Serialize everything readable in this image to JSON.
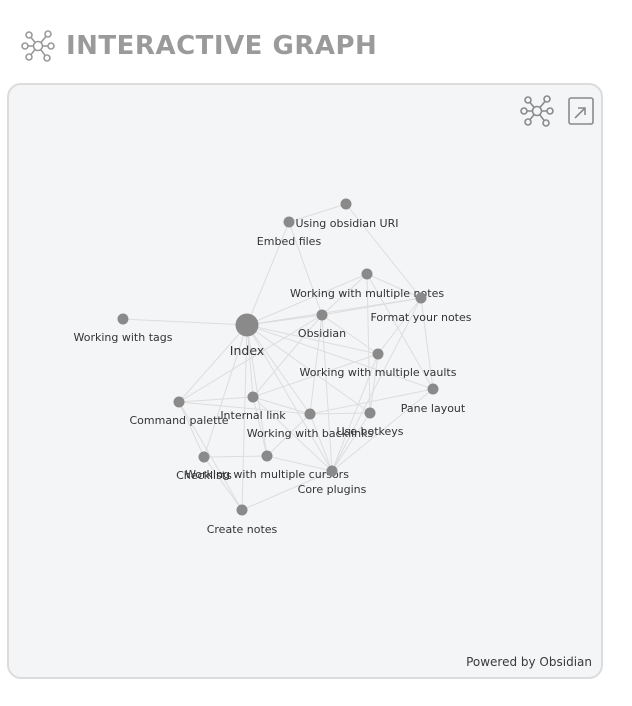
{
  "header": {
    "title": "INTERACTIVE GRAPH",
    "icon": "graph-network-icon"
  },
  "panel": {
    "toolbar": {
      "graph_icon": "graph-network-icon",
      "open_icon": "open-external-icon"
    },
    "footer": "Powered by Obsidian"
  },
  "colors": {
    "node": "#8a8a8a",
    "edge": "#dddddd",
    "panel_bg": "#f4f5f7",
    "header_text": "#9a9a9a"
  },
  "graph": {
    "nodes": [
      {
        "id": "top",
        "label": ""
      },
      {
        "id": "uri",
        "label": "Using obsidian URI"
      },
      {
        "id": "embed",
        "label": "Embed files"
      },
      {
        "id": "multnotes",
        "label": "Working with multiple notes"
      },
      {
        "id": "format",
        "label": "Format your notes"
      },
      {
        "id": "tags",
        "label": "Working with tags"
      },
      {
        "id": "index",
        "label": "Index"
      },
      {
        "id": "obsidian",
        "label": "Obsidian"
      },
      {
        "id": "vaults",
        "label": "Working with multiple vaults"
      },
      {
        "id": "pane",
        "label": "Pane layout"
      },
      {
        "id": "cmd",
        "label": "Command palette"
      },
      {
        "id": "internal",
        "label": "Internal link"
      },
      {
        "id": "backlinks",
        "label": "Working with backlinks"
      },
      {
        "id": "hotkeys",
        "label": "Use hotkeys"
      },
      {
        "id": "cursors",
        "label": "Working with multiple cursors"
      },
      {
        "id": "checklists",
        "label": "Checklists"
      },
      {
        "id": "core",
        "label": "Core plugins"
      },
      {
        "id": "create",
        "label": "Create notes"
      }
    ],
    "edges": [
      [
        "top",
        "embed"
      ],
      [
        "top",
        "format"
      ],
      [
        "uri",
        "embed"
      ],
      [
        "embed",
        "index"
      ],
      [
        "embed",
        "obsidian"
      ],
      [
        "index",
        "tags"
      ],
      [
        "index",
        "multnotes"
      ],
      [
        "index",
        "format"
      ],
      [
        "index",
        "obsidian"
      ],
      [
        "index",
        "vaults"
      ],
      [
        "index",
        "pane"
      ],
      [
        "index",
        "cmd"
      ],
      [
        "index",
        "internal"
      ],
      [
        "index",
        "backlinks"
      ],
      [
        "index",
        "hotkeys"
      ],
      [
        "index",
        "cursors"
      ],
      [
        "index",
        "checklists"
      ],
      [
        "index",
        "core"
      ],
      [
        "index",
        "create"
      ],
      [
        "multnotes",
        "format"
      ],
      [
        "multnotes",
        "obsidian"
      ],
      [
        "multnotes",
        "hotkeys"
      ],
      [
        "multnotes",
        "pane"
      ],
      [
        "format",
        "obsidian"
      ],
      [
        "format",
        "vaults"
      ],
      [
        "format",
        "core"
      ],
      [
        "format",
        "pane"
      ],
      [
        "obsidian",
        "vaults"
      ],
      [
        "obsidian",
        "cmd"
      ],
      [
        "obsidian",
        "internal"
      ],
      [
        "obsidian",
        "backlinks"
      ],
      [
        "obsidian",
        "core"
      ],
      [
        "vaults",
        "internal"
      ],
      [
        "vaults",
        "hotkeys"
      ],
      [
        "vaults",
        "core"
      ],
      [
        "pane",
        "backlinks"
      ],
      [
        "pane",
        "core"
      ],
      [
        "cmd",
        "internal"
      ],
      [
        "cmd",
        "backlinks"
      ],
      [
        "cmd",
        "checklists"
      ],
      [
        "cmd",
        "create"
      ],
      [
        "internal",
        "backlinks"
      ],
      [
        "internal",
        "cursors"
      ],
      [
        "internal",
        "core"
      ],
      [
        "backlinks",
        "hotkeys"
      ],
      [
        "backlinks",
        "cursors"
      ],
      [
        "backlinks",
        "core"
      ],
      [
        "cursors",
        "checklists"
      ],
      [
        "cursors",
        "core"
      ],
      [
        "checklists",
        "create"
      ],
      [
        "core",
        "create"
      ],
      [
        "hotkeys",
        "core"
      ]
    ]
  }
}
